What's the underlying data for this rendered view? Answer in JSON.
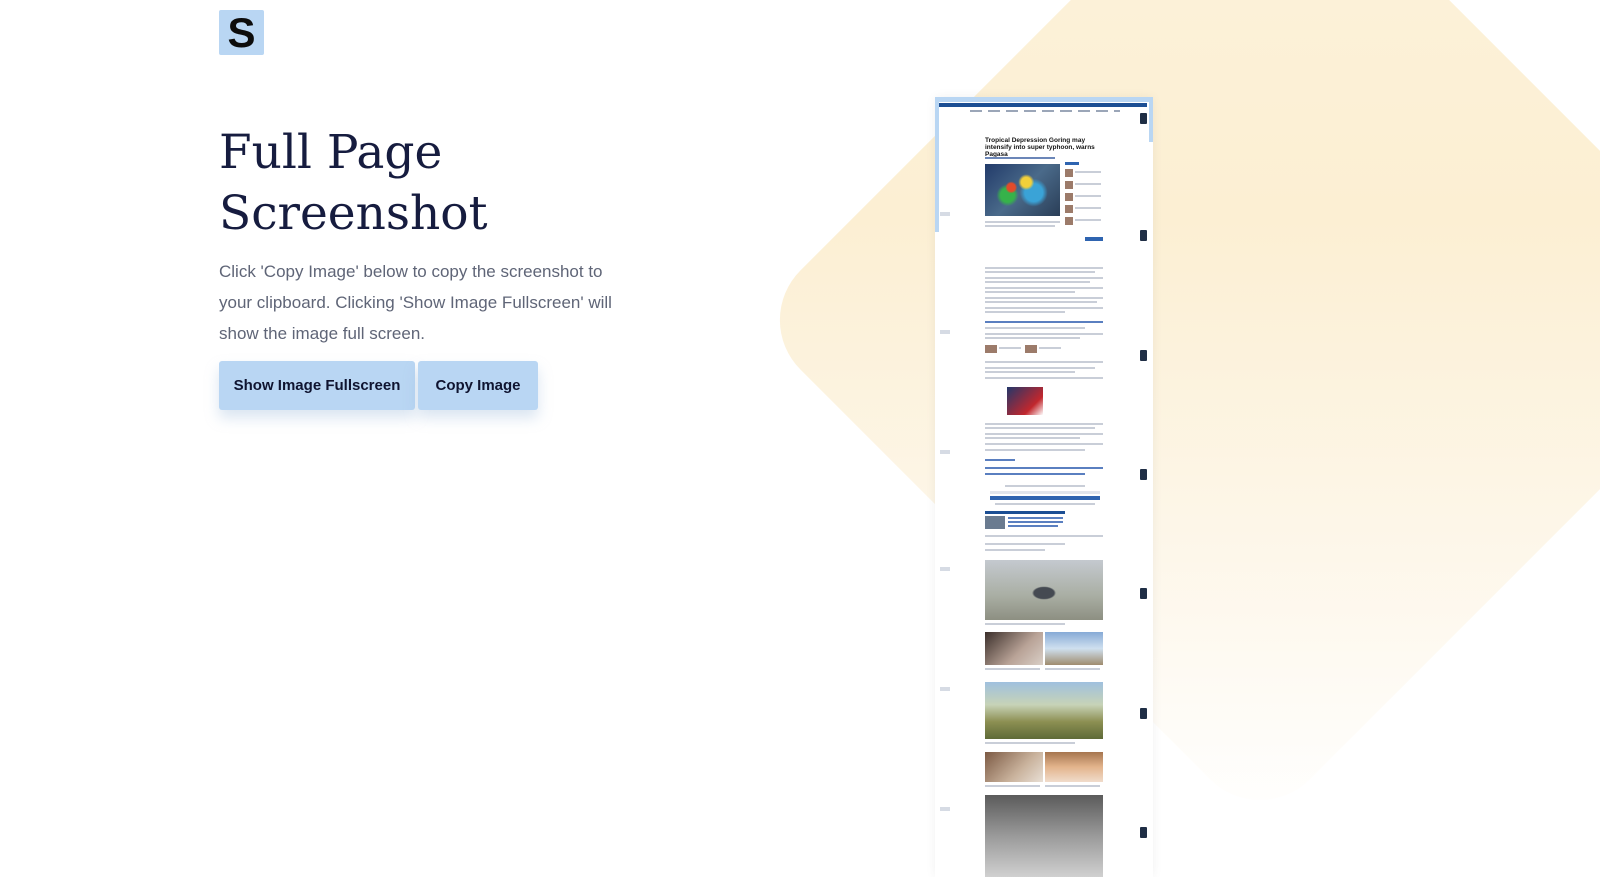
{
  "brand": {
    "logo_letter": "S",
    "accent_color": "#b9d6f3",
    "title_color": "#161c3f"
  },
  "hero": {
    "title": "Full Page Screenshot",
    "description": "Click 'Copy Image' below to copy the screenshot to your clipboard. Clicking 'Show Image Fullscreen' will show the image full screen."
  },
  "actions": {
    "show_fullscreen_label": "Show Image Fullscreen",
    "copy_image_label": "Copy Image"
  },
  "preview": {
    "headline": "Tropical Depression Goring may intensify into super typhoon, warns Pagasa"
  }
}
